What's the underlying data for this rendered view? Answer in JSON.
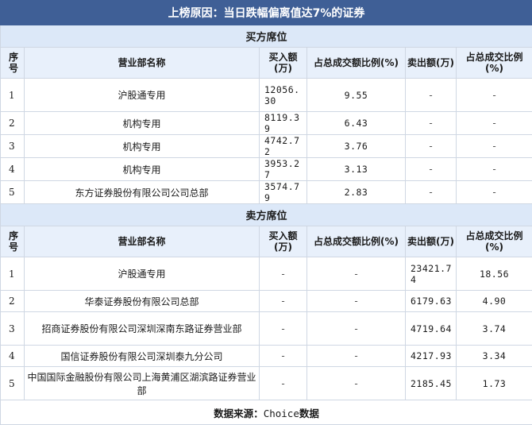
{
  "title": "上榜原因：当日跌幅偏离值达7%的证券",
  "columns": {
    "idx": "序号",
    "name": "营业部名称",
    "buy": "买入额(万)",
    "buy_ratio": "占总成交额比例(%)",
    "sell": "卖出额(万)",
    "sell_ratio": "占总成交比例(%)"
  },
  "buy_section": {
    "label": "买方席位",
    "rows": [
      {
        "idx": "1",
        "name": "沪股通专用",
        "buy": "12056.30",
        "buy_ratio": "9.55",
        "sell": "-",
        "sell_ratio": "-"
      },
      {
        "idx": "2",
        "name": "机构专用",
        "buy": "8119.39",
        "buy_ratio": "6.43",
        "sell": "-",
        "sell_ratio": "-"
      },
      {
        "idx": "3",
        "name": "机构专用",
        "buy": "4742.72",
        "buy_ratio": "3.76",
        "sell": "-",
        "sell_ratio": "-"
      },
      {
        "idx": "4",
        "name": "机构专用",
        "buy": "3953.27",
        "buy_ratio": "3.13",
        "sell": "-",
        "sell_ratio": "-"
      },
      {
        "idx": "5",
        "name": "东方证券股份有限公司公司总部",
        "buy": "3574.79",
        "buy_ratio": "2.83",
        "sell": "-",
        "sell_ratio": "-"
      }
    ]
  },
  "sell_section": {
    "label": "卖方席位",
    "rows": [
      {
        "idx": "1",
        "name": "沪股通专用",
        "buy": "-",
        "buy_ratio": "-",
        "sell": "23421.74",
        "sell_ratio": "18.56"
      },
      {
        "idx": "2",
        "name": "华泰证券股份有限公司总部",
        "buy": "-",
        "buy_ratio": "-",
        "sell": "6179.63",
        "sell_ratio": "4.90"
      },
      {
        "idx": "3",
        "name": "招商证券股份有限公司深圳深南东路证券营业部",
        "buy": "-",
        "buy_ratio": "-",
        "sell": "4719.64",
        "sell_ratio": "3.74"
      },
      {
        "idx": "4",
        "name": "国信证券股份有限公司深圳泰九分公司",
        "buy": "-",
        "buy_ratio": "-",
        "sell": "4217.93",
        "sell_ratio": "3.34"
      },
      {
        "idx": "5",
        "name": "中国国际金融股份有限公司上海黄浦区湖滨路证券营业部",
        "buy": "-",
        "buy_ratio": "-",
        "sell": "2185.45",
        "sell_ratio": "1.73"
      }
    ]
  },
  "source": {
    "prefix": "数据来源：",
    "brand": "Choice",
    "suffix": "数据"
  }
}
